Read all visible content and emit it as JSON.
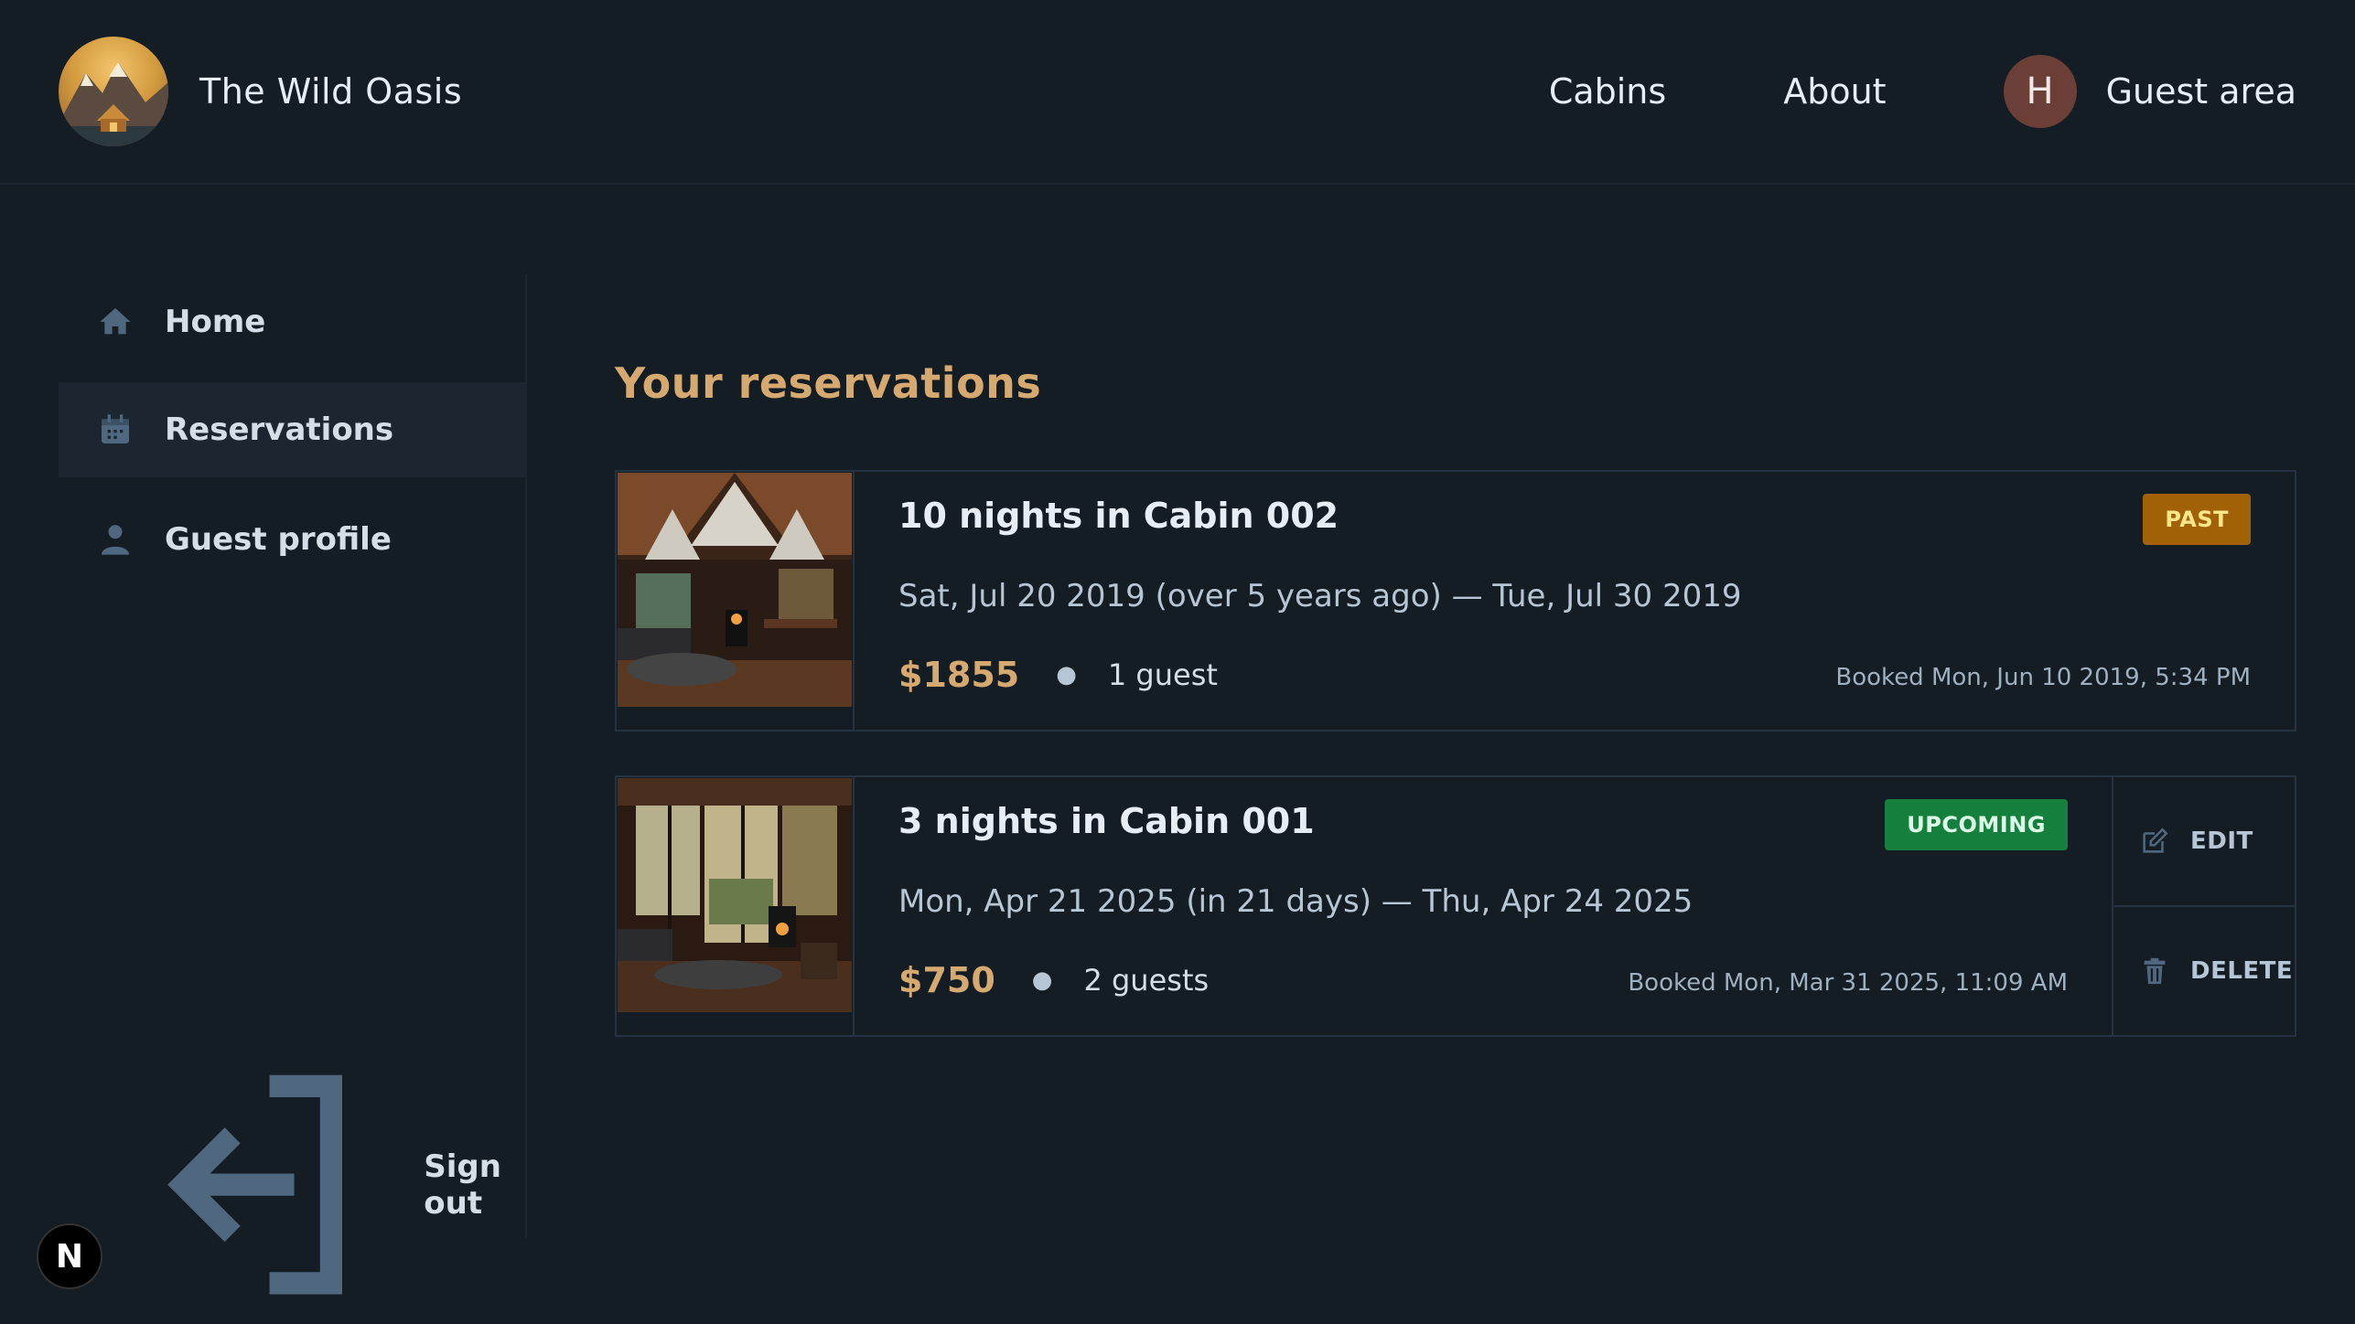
{
  "header": {
    "brand": "The Wild Oasis",
    "logo_icon": "mountain-cabin-logo",
    "nav": [
      {
        "label": "Cabins"
      },
      {
        "label": "About"
      }
    ],
    "guest_area": {
      "avatar_initial": "H",
      "label": "Guest area"
    }
  },
  "sidebar": {
    "items": [
      {
        "label": "Home",
        "icon": "home-icon",
        "active": false
      },
      {
        "label": "Reservations",
        "icon": "calendar-icon",
        "active": true
      },
      {
        "label": "Guest profile",
        "icon": "user-icon",
        "active": false
      }
    ],
    "sign_out": {
      "label": "Sign out",
      "icon": "sign-out-icon"
    }
  },
  "main": {
    "title": "Your reservations",
    "reservations": [
      {
        "title": "10 nights in Cabin 002",
        "dates": "Sat, Jul 20 2019 (over 5 years ago) — Tue, Jul 30 2019",
        "price": "$1855",
        "guests": "1 guest",
        "booked": "Booked Mon, Jun 10 2019, 5:34 PM",
        "status": "PAST"
      },
      {
        "title": "3 nights in Cabin 001",
        "dates": "Mon, Apr 21 2025 (in 21 days) — Thu, Apr 24 2025",
        "price": "$750",
        "guests": "2 guests",
        "booked": "Booked Mon, Mar 31 2025, 11:09 AM",
        "status": "UPCOMING",
        "actions": {
          "edit": "EDIT",
          "delete": "DELETE"
        }
      }
    ]
  },
  "dev_badge": {
    "label": "N"
  },
  "colors": {
    "background": "#141c24",
    "accent": "#d5a970",
    "past": "#a16207",
    "upcoming": "#15803d"
  }
}
